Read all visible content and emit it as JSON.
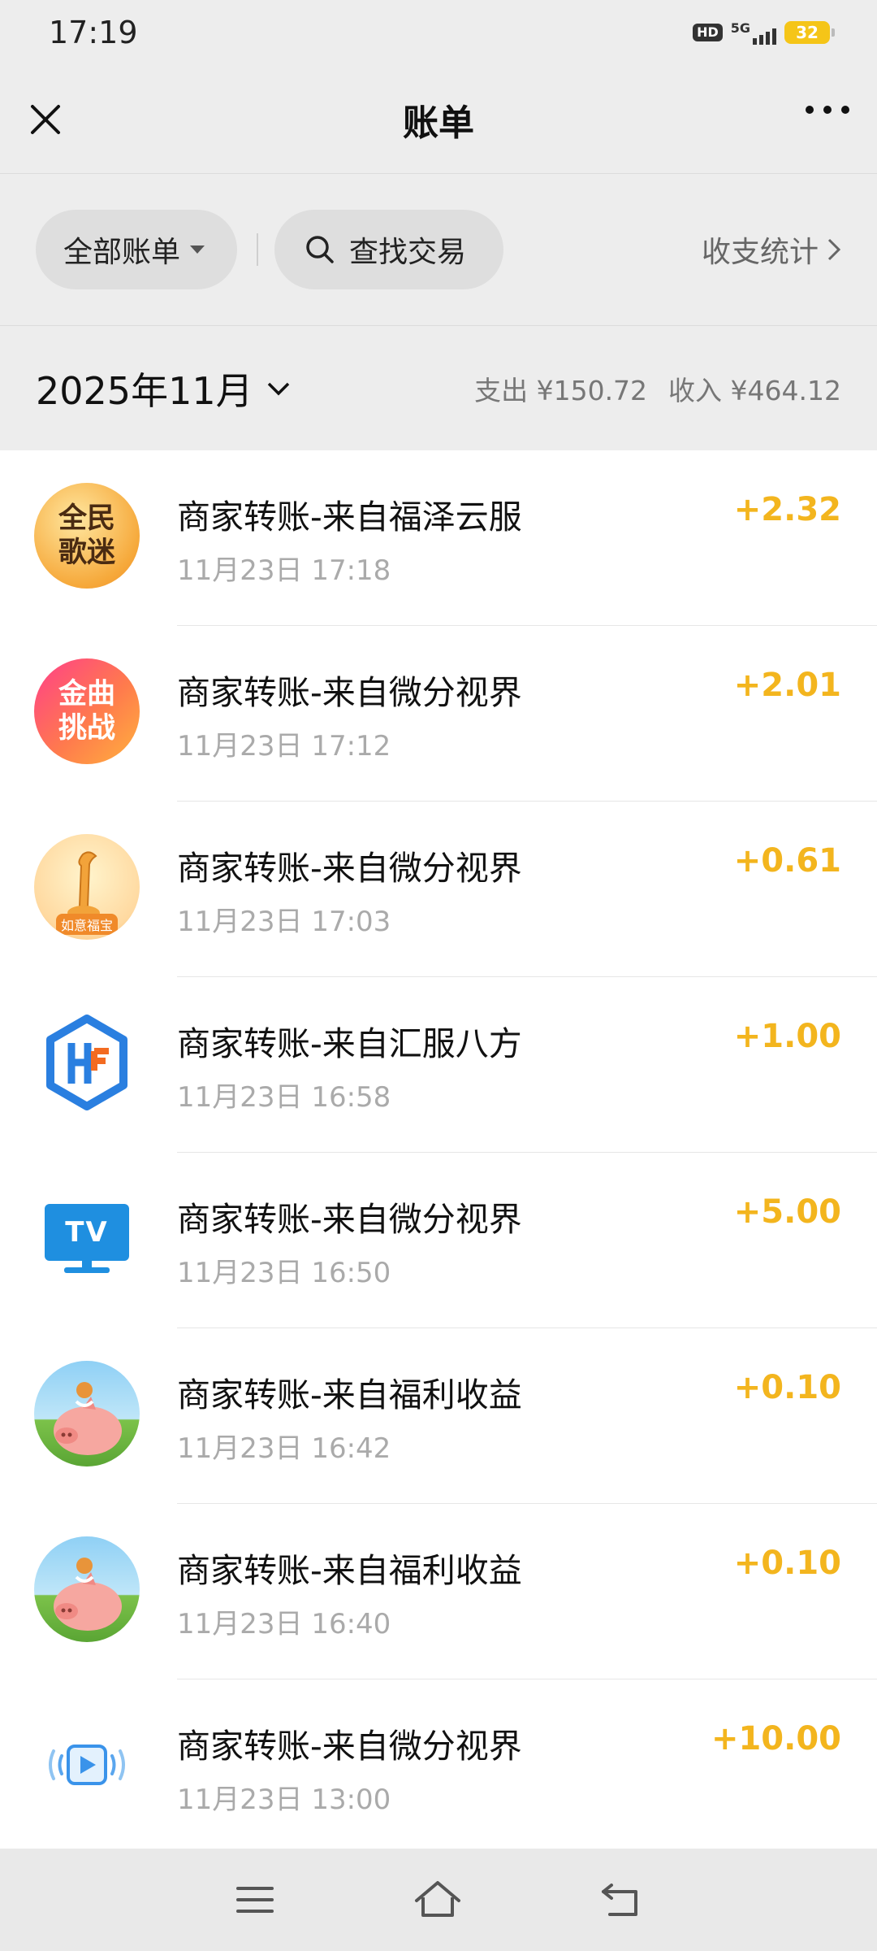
{
  "status_bar": {
    "time": "17:19",
    "battery": "32",
    "network": "5G",
    "hd": "HD"
  },
  "nav": {
    "title": "账单"
  },
  "filters": {
    "all_bills": "全部账单",
    "search": "查找交易",
    "stats": "收支统计"
  },
  "month": {
    "label": "2025年11月",
    "expense": "支出 ¥150.72",
    "income": "收入 ¥464.12"
  },
  "colors": {
    "amount": "#f3b51e",
    "background": "#ededed"
  },
  "transactions": [
    {
      "title": "商家转账-来自福泽云服",
      "time": "11月23日 17:18",
      "amount": "+2.32",
      "icon": "quanmin-gemi-app-icon",
      "icon_text": "全民歌迷"
    },
    {
      "title": "商家转账-来自微分视界",
      "time": "11月23日 17:12",
      "amount": "+2.01",
      "icon": "jinqu-tiaozhan-app-icon",
      "icon_text": "金曲挑战"
    },
    {
      "title": "商家转账-来自微分视界",
      "time": "11月23日 17:03",
      "amount": "+0.61",
      "icon": "ruyi-fubao-app-icon",
      "icon_text": "如意福宝"
    },
    {
      "title": "商家转账-来自汇服八方",
      "time": "11月23日 16:58",
      "amount": "+1.00",
      "icon": "hf-logo-icon",
      "icon_text": ""
    },
    {
      "title": "商家转账-来自微分视界",
      "time": "11月23日 16:50",
      "amount": "+5.00",
      "icon": "tv-icon",
      "icon_text": "TV"
    },
    {
      "title": "商家转账-来自福利收益",
      "time": "11月23日 16:42",
      "amount": "+0.10",
      "icon": "pig-app-icon",
      "icon_text": ""
    },
    {
      "title": "商家转账-来自福利收益",
      "time": "11月23日 16:40",
      "amount": "+0.10",
      "icon": "pig-app-icon",
      "icon_text": ""
    },
    {
      "title": "商家转账-来自微分视界",
      "time": "11月23日 13:00",
      "amount": "+10.00",
      "icon": "video-play-icon",
      "icon_text": ""
    }
  ]
}
